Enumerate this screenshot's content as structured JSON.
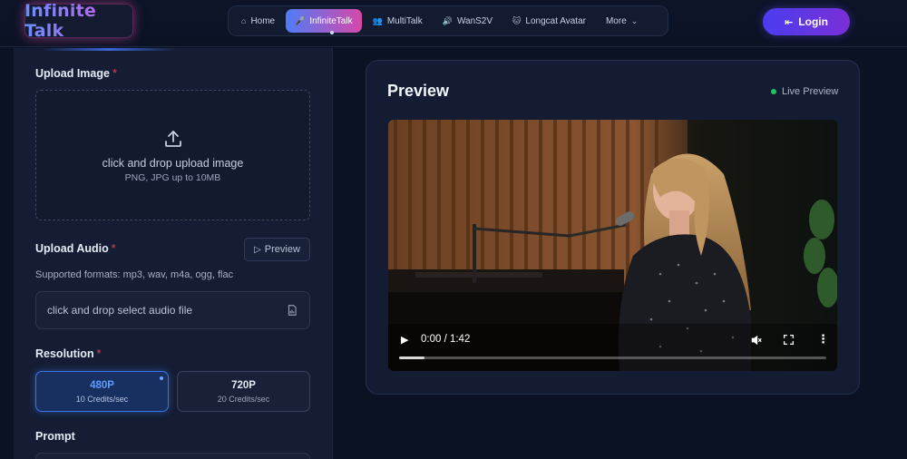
{
  "brand": {
    "name": "Infinite Talk"
  },
  "nav": {
    "items": [
      {
        "label": "Home",
        "icon": "home-icon"
      },
      {
        "label": "InfiniteTalk",
        "icon": "microphone-icon",
        "active": true
      },
      {
        "label": "MultiTalk",
        "icon": "people-icon"
      },
      {
        "label": "WanS2V",
        "icon": "speaker-icon"
      },
      {
        "label": "Longcat Avatar",
        "icon": "cat-icon"
      },
      {
        "label": "More",
        "icon": "chevron-down-icon"
      }
    ]
  },
  "login": {
    "label": "Login",
    "icon": "login-icon"
  },
  "form": {
    "upload_image": {
      "label": "Upload Image",
      "required_mark": "*",
      "drop_text": "click and drop upload image",
      "hint": "PNG, JPG up to 10MB"
    },
    "upload_audio": {
      "label": "Upload Audio",
      "required_mark": "*",
      "preview_label": "Preview",
      "formats": "Supported formats: mp3, wav, m4a, ogg, flac",
      "input_text": "click and drop select audio file"
    },
    "resolution": {
      "label": "Resolution",
      "required_mark": "*",
      "options": [
        {
          "title": "480P",
          "sub": "10 Credits/sec",
          "selected": true
        },
        {
          "title": "720P",
          "sub": "20 Credits/sec",
          "selected": false
        }
      ]
    },
    "prompt": {
      "label": "Prompt"
    }
  },
  "preview": {
    "title": "Preview",
    "live_label": "Live Preview",
    "player": {
      "time": "0:00 / 1:42",
      "progress": 0.06
    }
  },
  "colors": {
    "accent_blue": "#4f7cf7",
    "accent_pink": "#d748a8",
    "live_green": "#22c55e",
    "required_red": "#e0445b"
  }
}
